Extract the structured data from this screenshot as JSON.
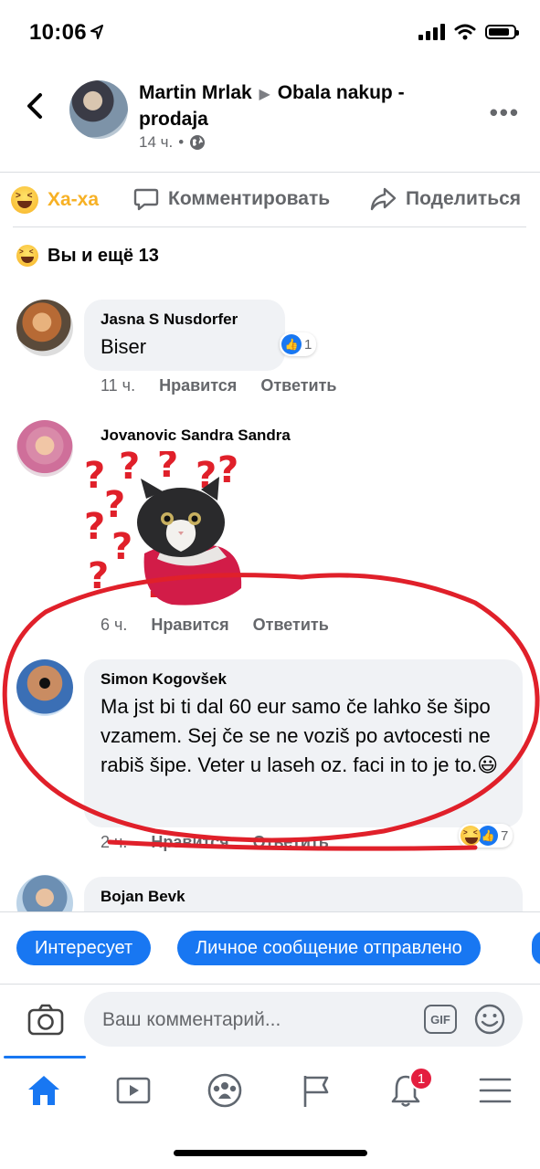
{
  "status_bar": {
    "time": "10:06"
  },
  "post_header": {
    "author": "Martin Mrlak",
    "group": "Obala nakup - prodaja",
    "time": "14 ч.",
    "separator": "•"
  },
  "actions": {
    "reaction_label": "Ха-ха",
    "comment_label": "Комментировать",
    "share_label": "Поделиться"
  },
  "reactions_summary": {
    "text": "Вы и ещё 13"
  },
  "comments": [
    {
      "name": "Jasna S Nusdorfer",
      "text": "Biser",
      "time": "11 ч.",
      "like": "Нравится",
      "reply": "Ответить",
      "reaction_count": "1"
    },
    {
      "name": "Jovanovic Sandra Sandra",
      "text": "",
      "time": "6 ч.",
      "like": "Нравится",
      "reply": "Ответить",
      "sticker": "confused-cat-sticker"
    },
    {
      "name": "Simon Kogovšek",
      "text": "Ma jst bi ti dal 60 eur samo če lahko še šipo vzamem. Sej če se ne voziš po avtocesti ne rabiš šipe. Veter u laseh oz. faci in to je to.😃",
      "time": "2 ч.",
      "like": "Нравится",
      "reply": "Ответить",
      "reaction_count": "7"
    },
    {
      "name": "Bojan Bevk"
    }
  ],
  "quick_replies": [
    "Интересует",
    "Личное сообщение отправлено"
  ],
  "composer": {
    "placeholder": "Ваш комментарий...",
    "gif_label": "GIF"
  },
  "tab_bar": {
    "items": [
      "home-icon",
      "watch-icon",
      "groups-icon",
      "pages-icon",
      "notifications-icon",
      "menu-icon"
    ],
    "notifications_badge": "1"
  },
  "colors": {
    "accent": "#1877f2",
    "haha": "#f7b125",
    "annotation": "#e0202a",
    "badge": "#e41e3f"
  }
}
